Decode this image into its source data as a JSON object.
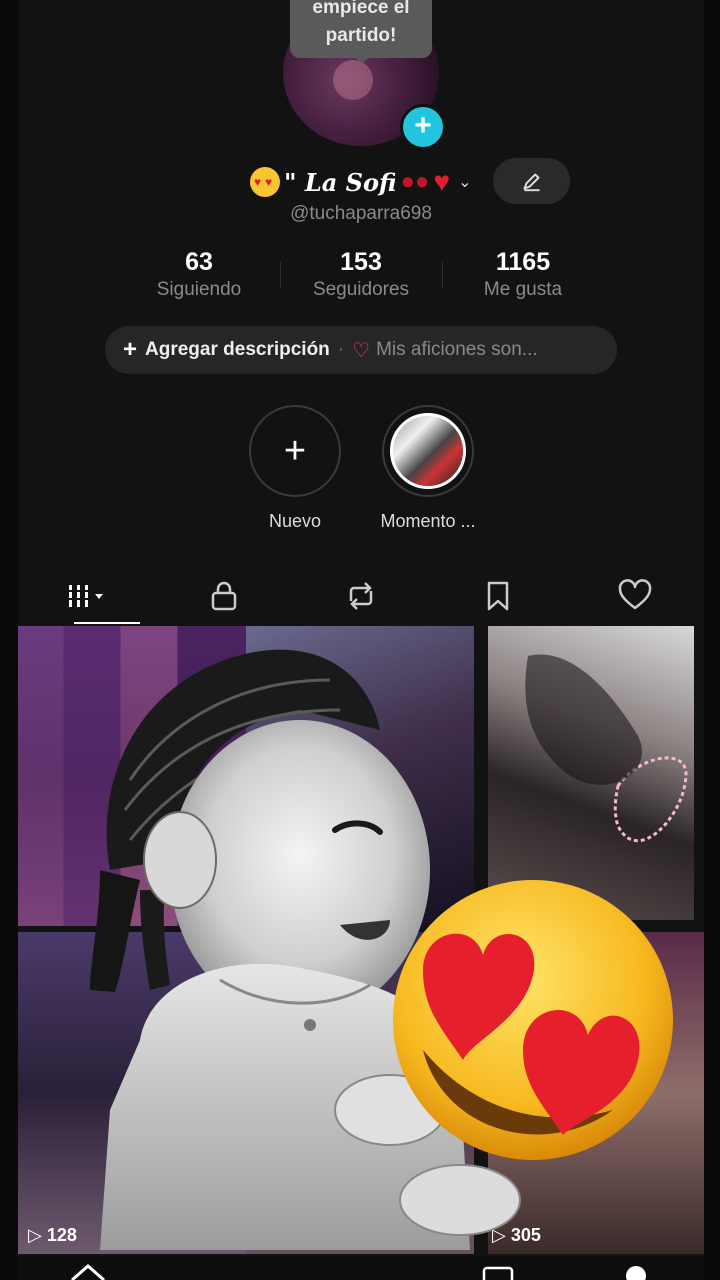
{
  "tooltip": {
    "text": "empiece el partido!"
  },
  "profile": {
    "display_name": "\" La Sofi",
    "handle": "@tuchaparra698"
  },
  "stats": [
    {
      "value": "63",
      "label": "Siguiendo"
    },
    {
      "value": "153",
      "label": "Seguidores"
    },
    {
      "value": "1165",
      "label": "Me gusta"
    }
  ],
  "description": {
    "add_label": "Agregar descripción",
    "separator": "·",
    "hobbies_label": "Mis aficiones son..."
  },
  "highlights": [
    {
      "label": "Nuevo"
    },
    {
      "label": "Momento ..."
    }
  ],
  "tabs": [
    "videos",
    "private",
    "reposts",
    "favorites",
    "liked"
  ],
  "grid": {
    "views": [
      "128",
      "305"
    ]
  },
  "icons": {
    "add_avatar": "plus-icon",
    "edit": "pencil-icon",
    "dropdown": "chevron-down-icon"
  },
  "colors": {
    "accent_cyan": "#22c4de",
    "heart_pink": "#ff3c7a",
    "background": "#121212"
  }
}
